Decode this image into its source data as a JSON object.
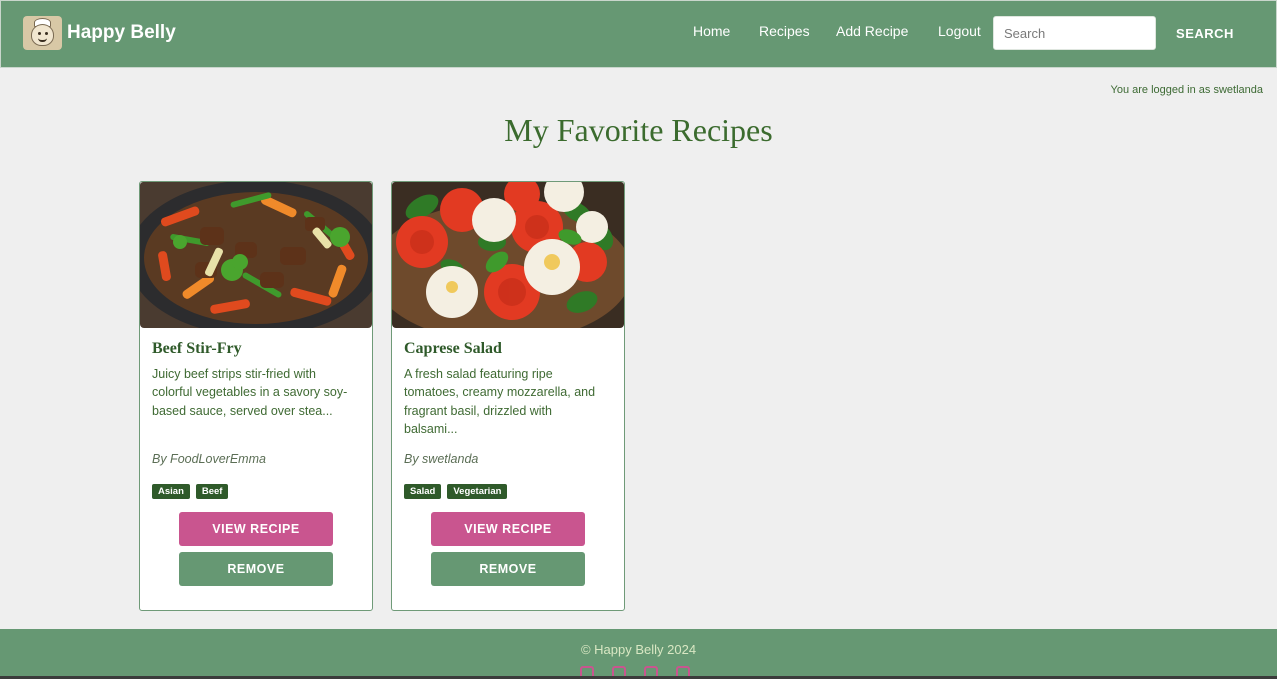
{
  "brand": {
    "name": "Happy Belly",
    "logo_icon": "chef-mascot-icon"
  },
  "nav": {
    "links": [
      "Home",
      "Recipes",
      "Add Recipe",
      "Logout"
    ],
    "search_placeholder": "Search",
    "search_button": "SEARCH"
  },
  "status": {
    "logged_in_text": "You are logged in as swetlanda"
  },
  "page": {
    "title": "My Favorite Recipes"
  },
  "recipes": [
    {
      "title": "Beef Stir-Fry",
      "description": "Juicy beef strips stir-fried with colorful vegetables in a savory soy-based sauce, served over stea...",
      "author": "By FoodLoverEmma",
      "tags": [
        "Asian",
        "Beef"
      ],
      "view_label": "VIEW RECIPE",
      "remove_label": "REMOVE"
    },
    {
      "title": "Caprese Salad",
      "description": "A fresh salad featuring ripe tomatoes, creamy mozzarella, and fragrant basil, drizzled with balsami...",
      "author": "By swetlanda",
      "tags": [
        "Salad",
        "Vegetarian"
      ],
      "view_label": "VIEW RECIPE",
      "remove_label": "REMOVE"
    }
  ],
  "footer": {
    "copyright": "© Happy Belly 2024",
    "social_icons": [
      "facebook-icon",
      "twitter-icon",
      "instagram-icon",
      "pinterest-icon"
    ]
  },
  "colors": {
    "header_green": "#669873",
    "title_green": "#3b6b2e",
    "tag_green": "#2f5a2a",
    "view_pink": "#c9558f",
    "background": "#efefef"
  }
}
